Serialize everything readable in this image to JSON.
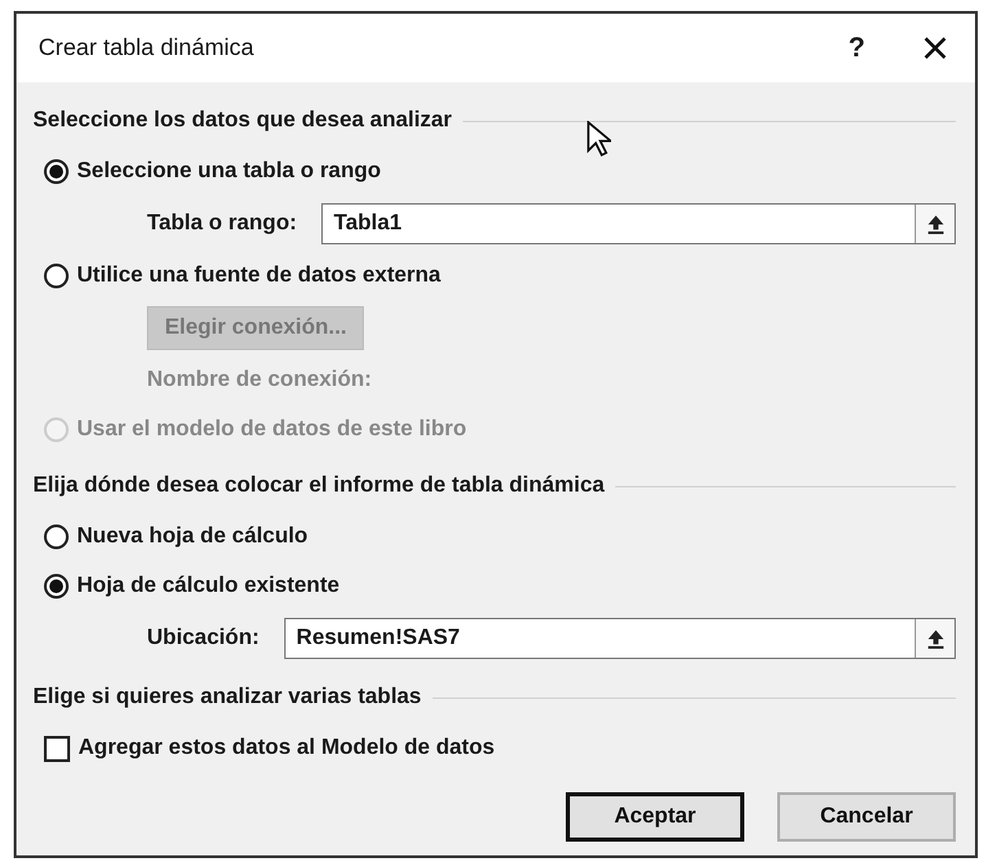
{
  "window": {
    "title": "Crear tabla dinámica",
    "help": "?"
  },
  "sections": [
    {
      "heading": "Seleccione los datos que desea analizar",
      "items": [
        {
          "kind": "radio",
          "label": "Seleccione una tabla o rango",
          "selected": true,
          "disabled": false
        },
        {
          "kind": "field",
          "label": "Tabla o rango:",
          "value": "Tabla1"
        },
        {
          "kind": "radio",
          "label": "Utilice una fuente de datos externa",
          "selected": false,
          "disabled": false
        },
        {
          "kind": "button",
          "label": "Elegir conexión...",
          "disabled": true
        },
        {
          "kind": "note",
          "label": "Nombre de conexión:"
        },
        {
          "kind": "radio",
          "label": "Usar el modelo de datos de este libro",
          "selected": false,
          "disabled": true
        }
      ]
    },
    {
      "heading": "Elija dónde desea colocar el informe de tabla dinámica",
      "items": [
        {
          "kind": "radio",
          "label": "Nueva hoja de cálculo",
          "selected": false,
          "disabled": false
        },
        {
          "kind": "radio",
          "label": "Hoja de cálculo existente",
          "selected": true,
          "disabled": false
        },
        {
          "kind": "field",
          "label": "Ubicación:",
          "value": "Resumen!SAS7"
        }
      ]
    },
    {
      "heading": "Elige si quieres analizar varias tablas",
      "items": [
        {
          "kind": "checkbox",
          "label": "Agregar estos datos al Modelo de datos",
          "checked": false
        }
      ]
    }
  ],
  "buttons": [
    {
      "label": "Aceptar",
      "default": true
    },
    {
      "label": "Cancelar",
      "default": false
    }
  ]
}
